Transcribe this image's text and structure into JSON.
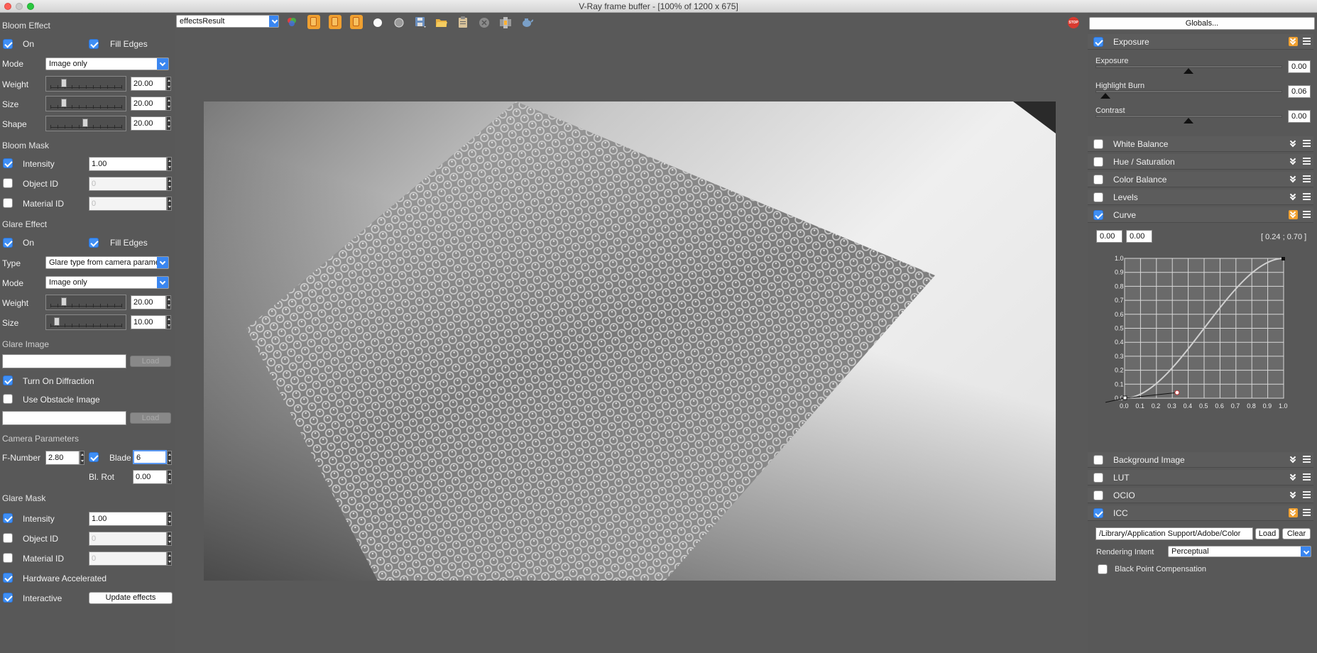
{
  "window": {
    "title": "V-Ray frame buffer - [100% of 1200 x 675]"
  },
  "toolbar": {
    "channel": "effectsResult",
    "buttons": [
      "color-channels-icon",
      "red-channel-icon",
      "green-channel-icon",
      "blue-channel-icon",
      "white-circle-icon",
      "gray-circle-icon",
      "save-icon",
      "open-folder-icon",
      "clipboard-icon",
      "clear-icon",
      "region-render-icon",
      "teapot-render-icon"
    ],
    "stop_label": "STOP"
  },
  "bloom": {
    "title": "Bloom Effect",
    "on_label": "On",
    "on": true,
    "fill_edges_label": "Fill Edges",
    "fill_edges": true,
    "mode_label": "Mode",
    "mode": "Image only",
    "weight_label": "Weight",
    "weight": "20.00",
    "size_label": "Size",
    "size": "20.00",
    "shape_label": "Shape",
    "shape": "20.00"
  },
  "bloom_mask": {
    "title": "Bloom Mask",
    "intensity_label": "Intensity",
    "intensity": "1.00",
    "intensity_on": true,
    "object_id_label": "Object ID",
    "object_id": "0",
    "material_id_label": "Material ID",
    "material_id": "0"
  },
  "glare": {
    "title": "Glare Effect",
    "on_label": "On",
    "on": true,
    "fill_edges_label": "Fill Edges",
    "fill_edges": true,
    "type_label": "Type",
    "type": "Glare type from camera parameters",
    "mode_label": "Mode",
    "mode": "Image only",
    "weight_label": "Weight",
    "weight": "20.00",
    "size_label": "Size",
    "size": "10.00"
  },
  "glare_image": {
    "title": "Glare Image",
    "load_label": "Load",
    "diffraction_label": "Turn On Diffraction",
    "diffraction": true,
    "obstacle_label": "Use Obstacle Image",
    "obstacle": false,
    "load2_label": "Load"
  },
  "camera": {
    "title": "Camera Parameters",
    "fnumber_label": "F-Number",
    "fnumber": "2.80",
    "blade_label": "Blade",
    "blade": "6",
    "blade_on": true,
    "blrot_label": "Bl. Rot",
    "blrot": "0.00"
  },
  "glare_mask": {
    "title": "Glare Mask",
    "intensity_label": "Intensity",
    "intensity": "1.00",
    "object_id_label": "Object ID",
    "object_id": "0",
    "material_id_label": "Material ID",
    "material_id": "0",
    "hw_label": "Hardware Accelerated",
    "hw": true,
    "interactive_label": "Interactive",
    "interactive": true,
    "update_label": "Update effects"
  },
  "right": {
    "globals_label": "Globals...",
    "exposure": {
      "title": "Exposure",
      "on": true,
      "exposure_label": "Exposure",
      "exposure": "0.00",
      "highlight_label": "Highlight Burn",
      "highlight": "0.06",
      "contrast_label": "Contrast",
      "contrast": "0.00"
    },
    "sections": [
      {
        "label": "White Balance",
        "on": false
      },
      {
        "label": "Hue / Saturation",
        "on": false
      },
      {
        "label": "Color Balance",
        "on": false
      },
      {
        "label": "Levels",
        "on": false
      }
    ],
    "curve": {
      "title": "Curve",
      "on": true,
      "in_value": "0.00",
      "out_value": "0.00",
      "coords": "[ 0.24 ; 0.70 ]",
      "y_ticks": [
        "1.0",
        "0.9",
        "0.8",
        "0.7",
        "0.6",
        "0.5",
        "0.4",
        "0.3",
        "0.2",
        "0.1",
        "0.0"
      ],
      "x_ticks": [
        "0.0",
        "0.1",
        "0.2",
        "0.3",
        "0.4",
        "0.5",
        "0.6",
        "0.7",
        "0.8",
        "0.9",
        "1.0"
      ]
    },
    "sections2": [
      {
        "label": "Background Image",
        "on": false
      },
      {
        "label": "LUT",
        "on": false
      },
      {
        "label": "OCIO",
        "on": false
      }
    ],
    "icc": {
      "title": "ICC",
      "on": true,
      "path": "/Library/Application Support/Adobe/Color",
      "load_label": "Load",
      "clear_label": "Clear",
      "intent_label": "Rendering Intent",
      "intent": "Perceptual",
      "bpc_label": "Black Point Compensation",
      "bpc": false
    }
  }
}
